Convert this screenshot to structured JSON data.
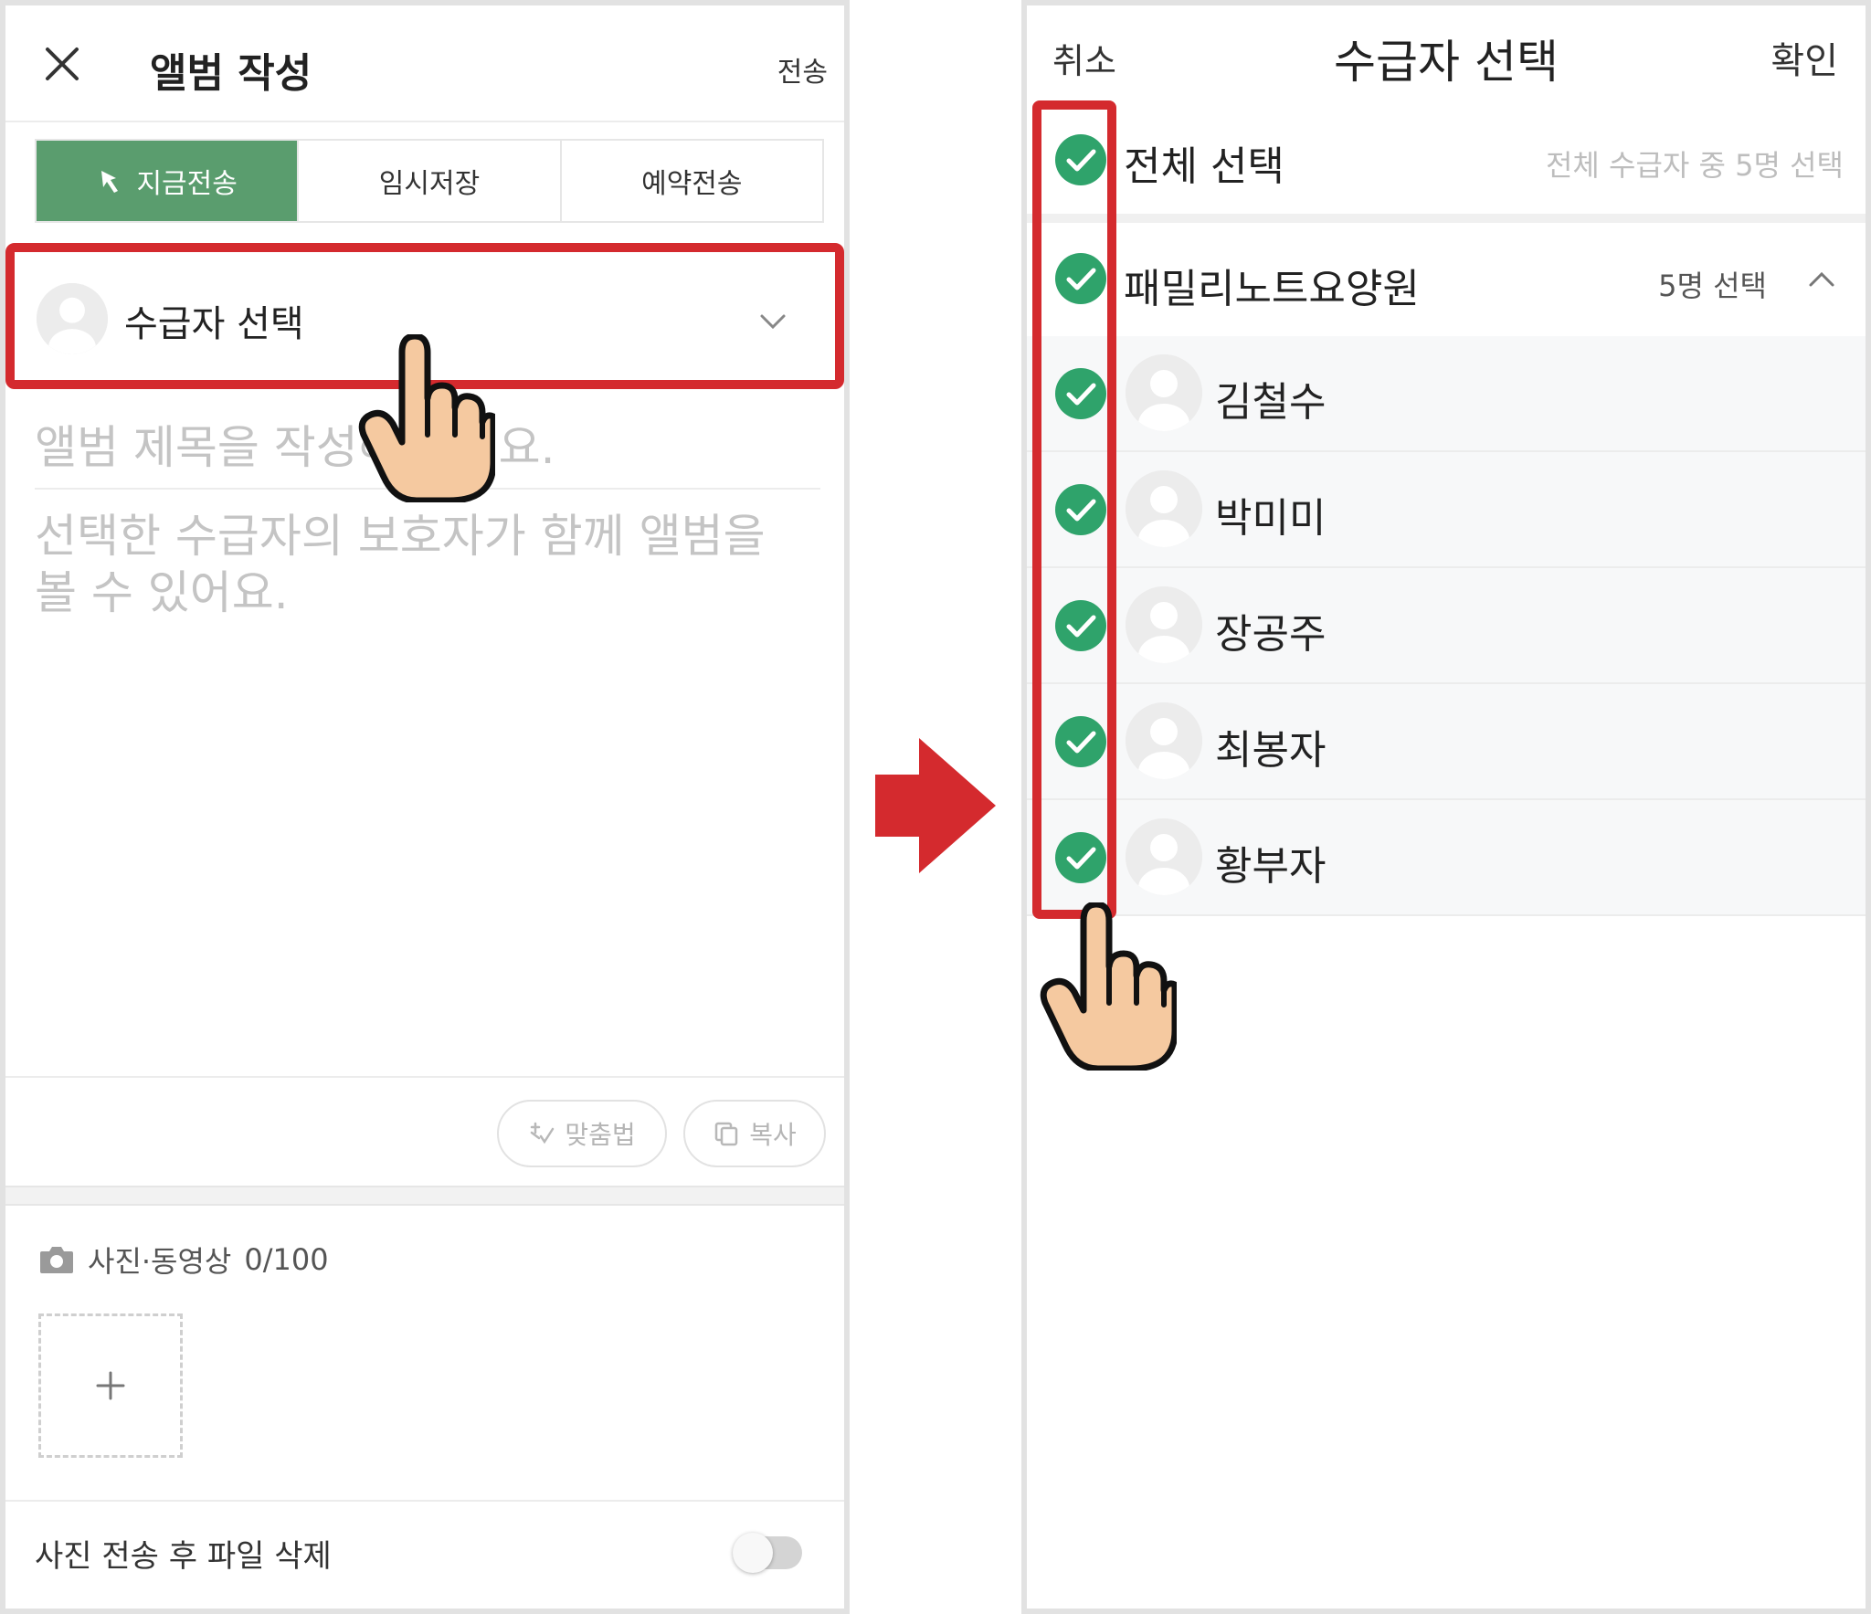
{
  "left": {
    "header": {
      "title": "앨범 작성",
      "send_label": "전송"
    },
    "mode_tabs": [
      {
        "label": "지금전송",
        "active": true
      },
      {
        "label": "임시저장",
        "active": false
      },
      {
        "label": "예약전송",
        "active": false
      }
    ],
    "recipient": {
      "label": "수급자 선택"
    },
    "album": {
      "title_placeholder": "앨범 제목을 작성해 주세요.",
      "body_placeholder": "선택한 수급자의 보호자가 함께 앨범을 볼 수 있어요."
    },
    "tools": {
      "spell_label": "맞춤법",
      "copy_label": "복사"
    },
    "media": {
      "label": "사진·동영상",
      "count": "0/100"
    },
    "delete_after_send": {
      "label": "사진 전송 후 파일 삭제",
      "enabled": false
    }
  },
  "right": {
    "header": {
      "cancel_label": "취소",
      "title": "수급자 선택",
      "confirm_label": "확인"
    },
    "select_all": {
      "label": "전체 선택",
      "status": "전체 수급자 중 5명 선택",
      "checked": true
    },
    "group": {
      "name": "패밀리노트요양원",
      "count": "5명 선택",
      "checked": true,
      "expanded": true
    },
    "members": [
      {
        "name": "김철수",
        "checked": true
      },
      {
        "name": "박미미",
        "checked": true
      },
      {
        "name": "장공주",
        "checked": true
      },
      {
        "name": "최봉자",
        "checked": true
      },
      {
        "name": "황부자",
        "checked": true
      }
    ]
  },
  "colors": {
    "accent_green": "#5a9d6e",
    "check_green": "#2fa36b",
    "highlight_red": "#d42a2e",
    "hand_skin": "#f5c9a0"
  },
  "icons": [
    "close-icon",
    "pin-icon",
    "chevron-down-icon",
    "spellcheck-icon",
    "copy-icon",
    "camera-icon",
    "plus-icon",
    "check-circle-icon",
    "chevron-up-icon",
    "pointing-hand-icon",
    "arrow-right-icon"
  ]
}
